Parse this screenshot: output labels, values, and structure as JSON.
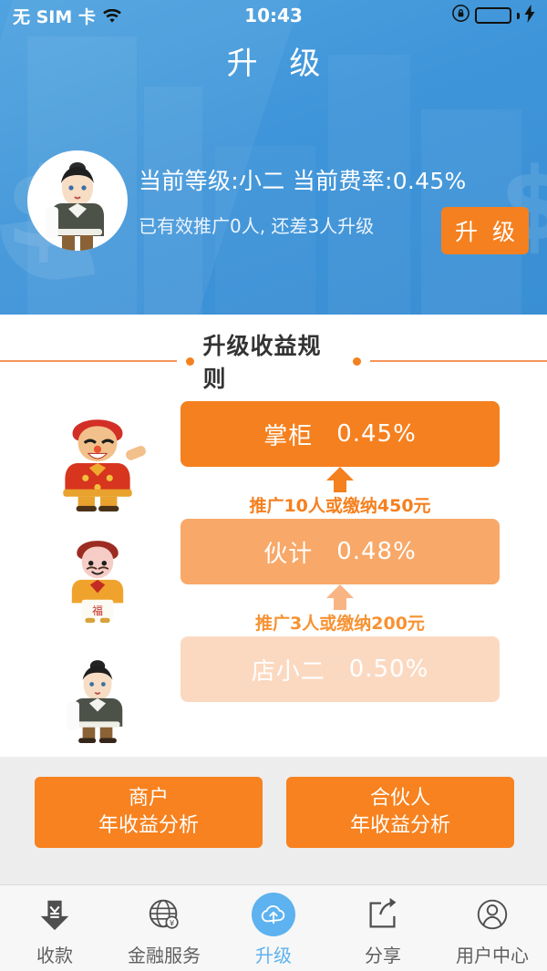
{
  "status_bar": {
    "carrier": "无 SIM 卡",
    "wifi_icon": "wifi-icon",
    "time": "10:43",
    "rotation_lock_icon": "rotation-lock-icon",
    "battery_icon": "battery-icon",
    "charging_icon": "lightning-bolt-icon",
    "battery_color": "#4cf04c"
  },
  "header": {
    "title": "升 级",
    "background_color": "#3f95d9"
  },
  "profile": {
    "avatar_icon": "waiter-avatar",
    "level_line": "当前等级:小二  当前费率:0.45%",
    "promo_line": "已有效推广0人, 还差3人升级",
    "upgrade_button": "升 级",
    "upgrade_button_color": "#f5801f"
  },
  "rules": {
    "section_title": "升级收益规则",
    "accent_color": "#f5801f",
    "tiers": [
      {
        "character_icon": "shopkeeper-character",
        "name": "掌柜",
        "rate": "0.45%",
        "bar_color": "#f5801f"
      },
      {
        "character_icon": "clerk-character",
        "name": "伙计",
        "rate": "0.48%",
        "bar_color": "#f8a868"
      },
      {
        "character_icon": "waiter-character",
        "name": "店小二",
        "rate": "0.50%",
        "bar_color": "#fbd9c1"
      }
    ],
    "steps": [
      {
        "note": "推广10人或缴纳450元",
        "arrow_icon": "up-arrow-icon",
        "color": "#f5801f"
      },
      {
        "note": "推广3人或缴纳200元",
        "arrow_icon": "up-arrow-icon",
        "color": "#f79233"
      }
    ]
  },
  "analysis": {
    "background_color": "#ededed",
    "buttons": [
      {
        "line1": "商户",
        "line2": "年收益分析"
      },
      {
        "line1": "合伙人",
        "line2": "年收益分析"
      }
    ]
  },
  "nav": {
    "active_color": "#5db2ef",
    "items": [
      {
        "label": "收款",
        "icon": "yen-down-arrow-icon",
        "active": false
      },
      {
        "label": "金融服务",
        "icon": "globe-icon",
        "active": false
      },
      {
        "label": "升级",
        "icon": "cloud-upload-icon",
        "active": true
      },
      {
        "label": "分享",
        "icon": "share-icon",
        "active": false
      },
      {
        "label": "用户中心",
        "icon": "user-circle-icon",
        "active": false
      }
    ]
  }
}
